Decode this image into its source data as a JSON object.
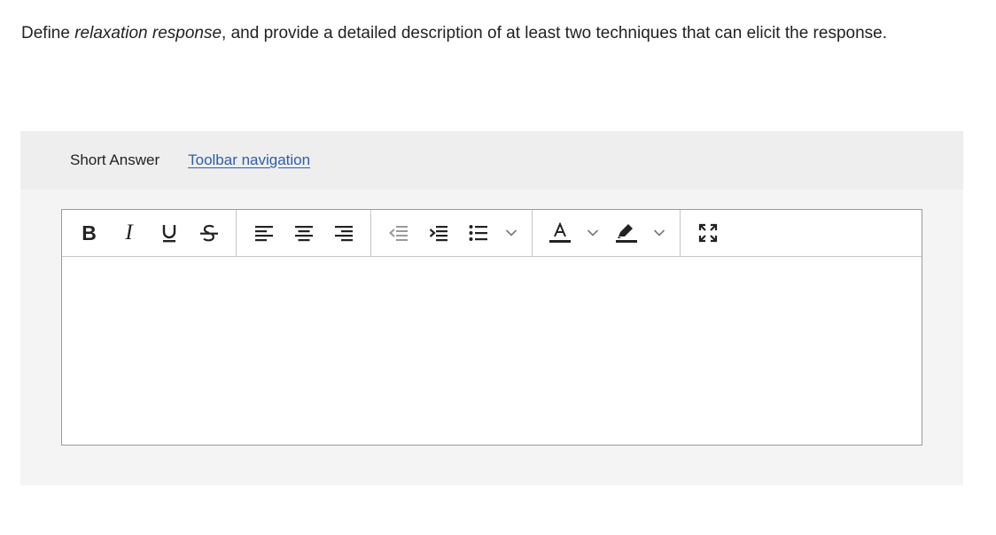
{
  "question": {
    "prefix": "Define ",
    "term": "relaxation response",
    "suffix": ", and provide a detailed description of at least two techniques that can elicit the response."
  },
  "panel": {
    "title": "Short Answer",
    "toolbar_nav_link": "Toolbar navigation "
  },
  "toolbar": {
    "groups": [
      [
        "bold-icon",
        "italic-icon",
        "underline-icon",
        "strikethrough-icon"
      ],
      [
        "align-left-icon",
        "align-center-icon",
        "align-right-icon"
      ],
      [
        "outdent-icon",
        "indent-icon",
        "bulleted-list-icon",
        "chevron-down-icon"
      ],
      [
        "font-color-icon",
        "chevron-down-icon",
        "highlight-color-icon",
        "chevron-down-icon"
      ],
      [
        "fullscreen-icon"
      ]
    ],
    "bold_glyph": "B",
    "italic_glyph": "I"
  },
  "editor": {
    "value": ""
  },
  "colors": {
    "link": "#2f5ea8",
    "panel_background": "#f4f4f4",
    "header_background": "#eeeeee",
    "text": "#222222"
  }
}
